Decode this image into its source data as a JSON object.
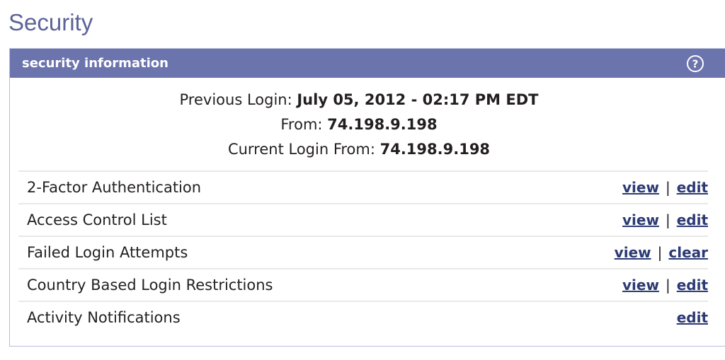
{
  "page": {
    "title": "Security",
    "title_color": "#5c6399"
  },
  "panel": {
    "header_title": "security information",
    "header_bg": "#6b74ad",
    "help_icon": "question-circle-icon",
    "border_color": "#b9bcd9"
  },
  "login_info": [
    {
      "label": "Previous Login:",
      "value": "July 05, 2012 - 02:17 PM EDT"
    },
    {
      "label": "From:",
      "value": "74.198.9.198"
    },
    {
      "label": "Current Login From:",
      "value": "74.198.9.198"
    }
  ],
  "rows": [
    {
      "label": "2-Factor Authentication",
      "actions": [
        {
          "label": "view"
        },
        {
          "label": "edit"
        }
      ],
      "separator": "|"
    },
    {
      "label": "Access Control List",
      "actions": [
        {
          "label": "view"
        },
        {
          "label": "edit"
        }
      ],
      "separator": "|"
    },
    {
      "label": "Failed Login Attempts",
      "actions": [
        {
          "label": "view"
        },
        {
          "label": "clear"
        }
      ],
      "separator": "|"
    },
    {
      "label": "Country Based Login Restrictions",
      "actions": [
        {
          "label": "view"
        },
        {
          "label": "edit"
        }
      ],
      "separator": "|"
    },
    {
      "label": "Activity Notifications",
      "actions": [
        {
          "label": "edit"
        }
      ],
      "separator": "|"
    }
  ],
  "colors": {
    "link": "#2b3a73",
    "text": "#231f20",
    "divider": "#e8e8e8"
  }
}
